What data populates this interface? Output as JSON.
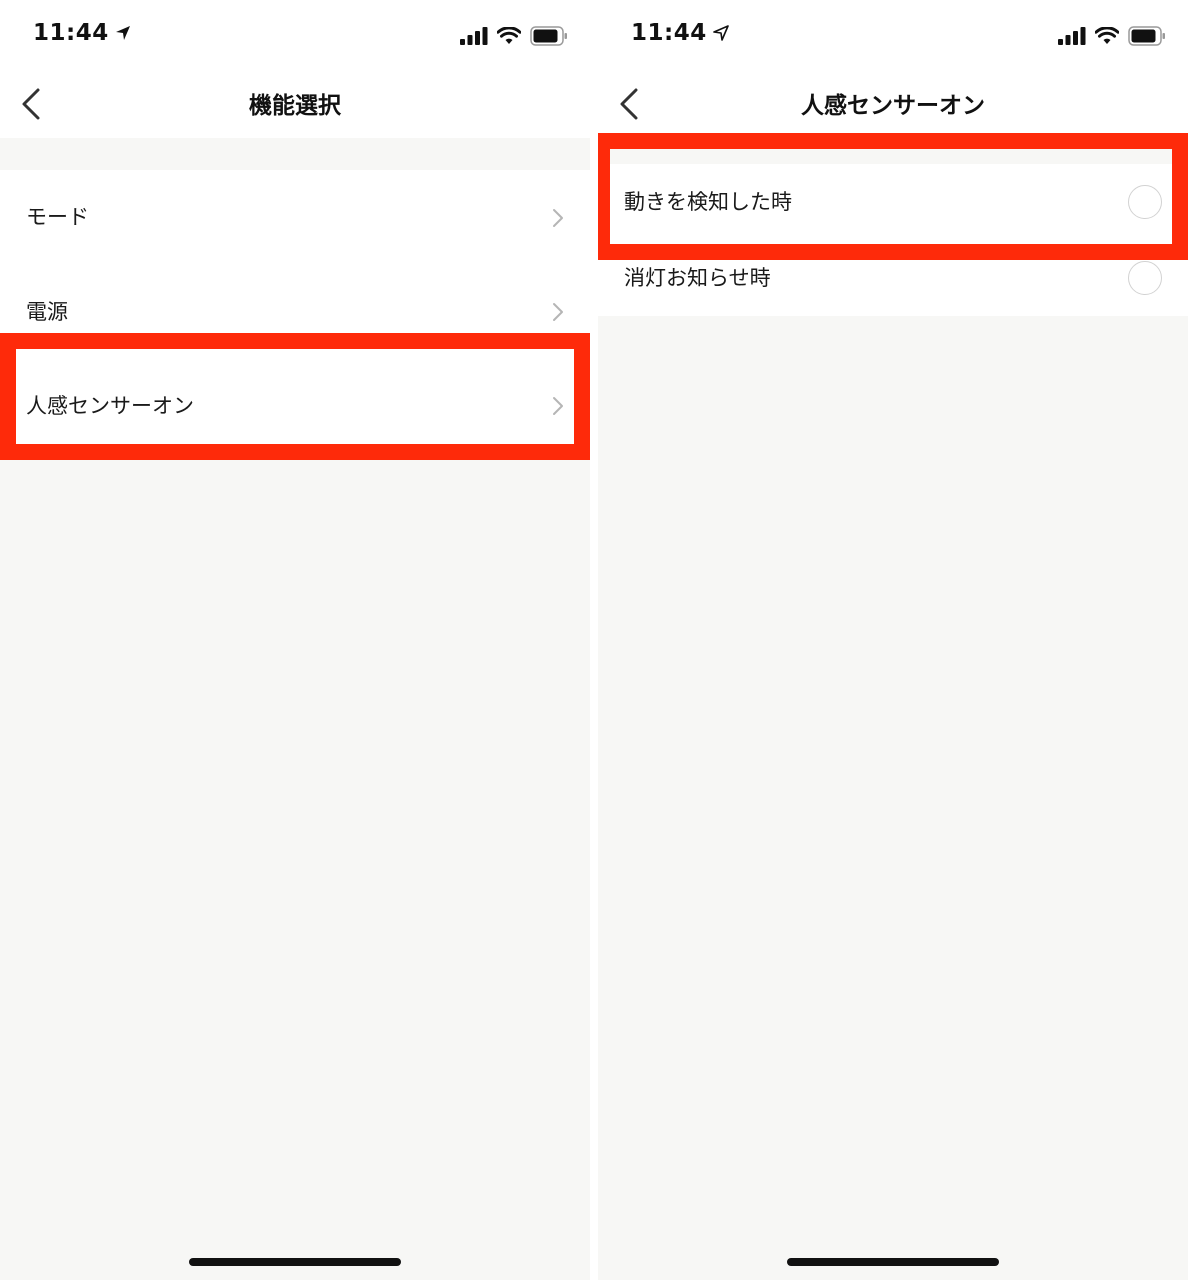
{
  "left_screen": {
    "status": {
      "time": "11:44"
    },
    "nav": {
      "title": "機能選択"
    },
    "rows": [
      {
        "label": "モード"
      },
      {
        "label": "電源"
      },
      {
        "label": "人感センサーオン"
      }
    ]
  },
  "right_screen": {
    "status": {
      "time": "11:44"
    },
    "nav": {
      "title": "人感センサーオン"
    },
    "options": [
      {
        "label": "動きを検知した時",
        "selected": false
      },
      {
        "label": "消灯お知らせ時",
        "selected": false
      }
    ]
  },
  "colors": {
    "highlight": "#fe2a0a",
    "background": "#f7f7f5",
    "surface": "#ffffff"
  }
}
